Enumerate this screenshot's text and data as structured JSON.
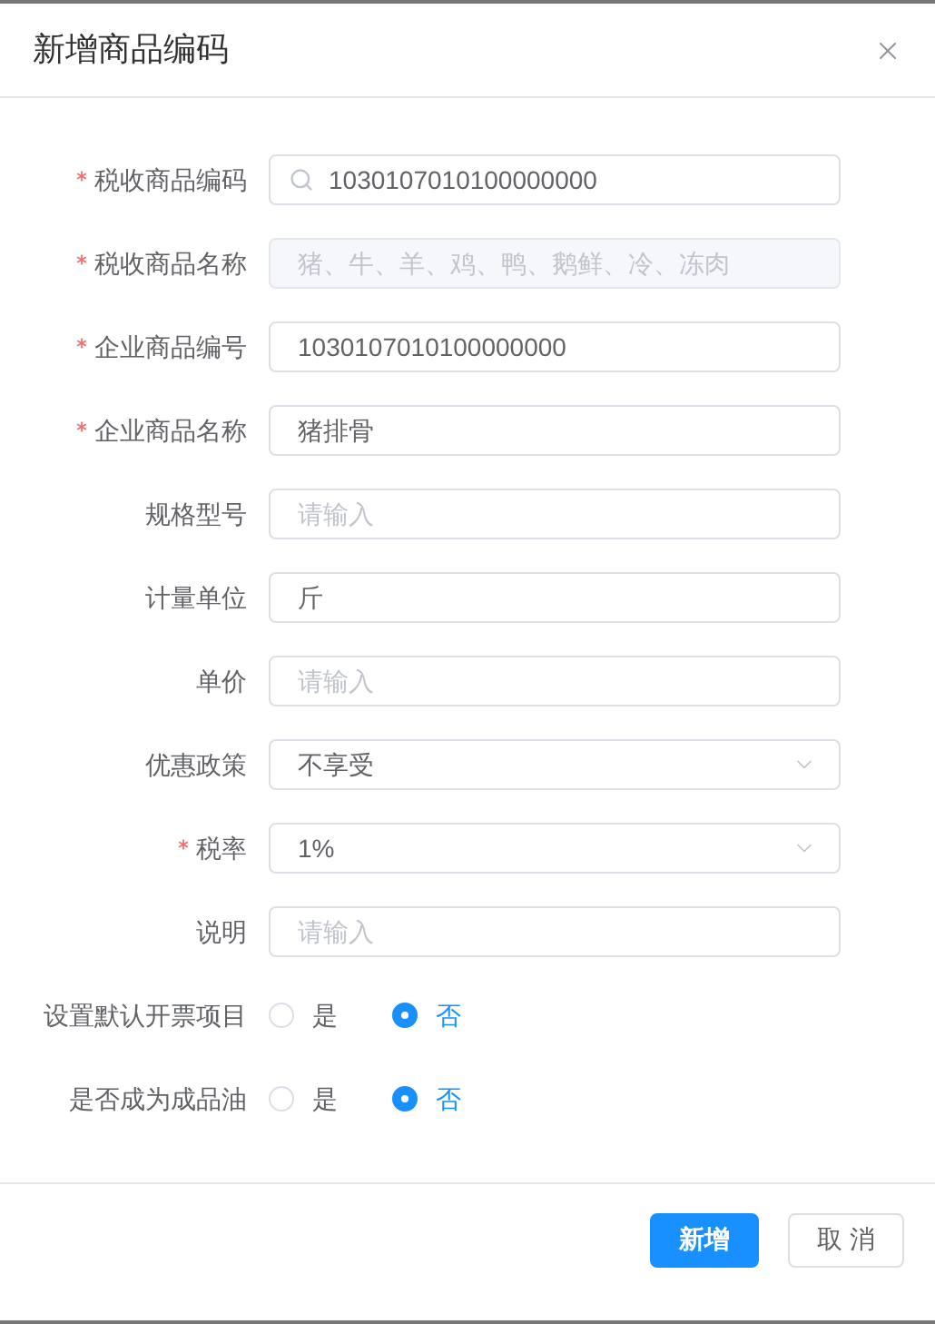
{
  "dialog": {
    "title": "新增商品编码"
  },
  "fields": [
    {
      "label": "税收商品编码",
      "required": true,
      "kind": "search",
      "value": "1030107010100000000"
    },
    {
      "label": "税收商品名称",
      "required": true,
      "kind": "disabled",
      "value": "猪、牛、羊、鸡、鸭、鹅鲜、冷、冻肉"
    },
    {
      "label": "企业商品编号",
      "required": true,
      "kind": "input",
      "value": "1030107010100000000"
    },
    {
      "label": "企业商品名称",
      "required": true,
      "kind": "input",
      "value": "猪排骨"
    },
    {
      "label": "规格型号",
      "required": false,
      "kind": "input",
      "placeholder": "请输入"
    },
    {
      "label": "计量单位",
      "required": false,
      "kind": "input",
      "value": "斤"
    },
    {
      "label": "单价",
      "required": false,
      "kind": "input",
      "placeholder": "请输入"
    },
    {
      "label": "优惠政策",
      "required": false,
      "kind": "select",
      "value": "不享受"
    },
    {
      "label": "税率",
      "required": true,
      "kind": "select",
      "value": "1%"
    },
    {
      "label": "说明",
      "required": false,
      "kind": "input",
      "placeholder": "请输入"
    }
  ],
  "radio_groups": [
    {
      "label": "设置默认开票项目",
      "options": [
        {
          "label": "是",
          "selected": false
        },
        {
          "label": "否",
          "selected": true
        }
      ]
    },
    {
      "label": "是否成为成品油",
      "options": [
        {
          "label": "是",
          "selected": false
        },
        {
          "label": "否",
          "selected": true
        }
      ]
    }
  ],
  "buttons": [
    {
      "label": "新增",
      "kind": "primary"
    },
    {
      "label": "取 消",
      "kind": "default"
    }
  ]
}
